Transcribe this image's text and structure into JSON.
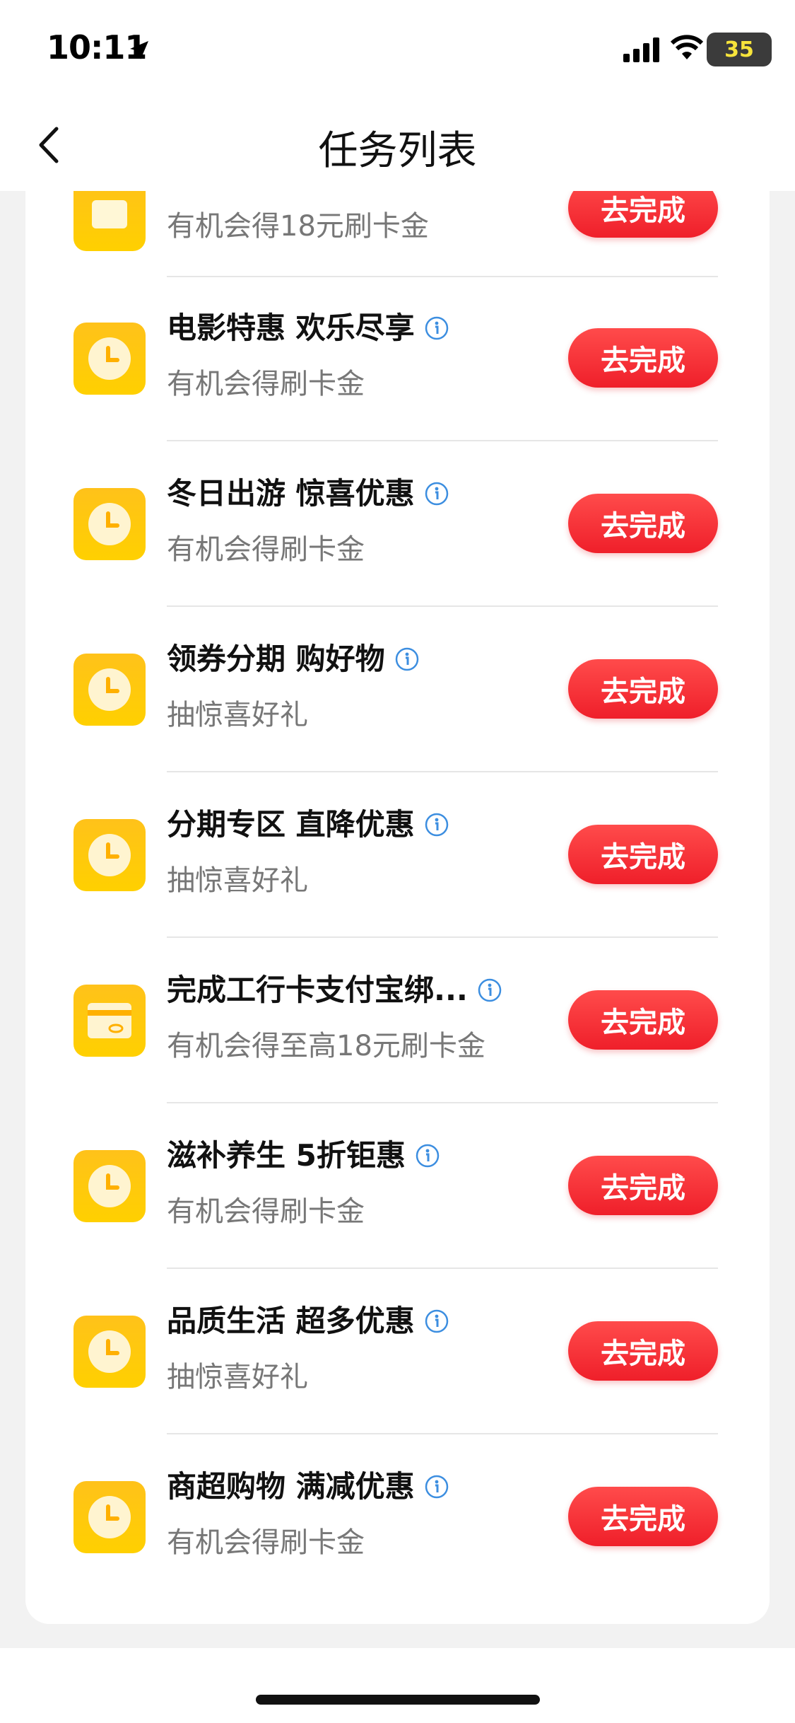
{
  "status_bar": {
    "time": "10:11",
    "battery": "35",
    "icons": [
      "location-arrow-icon",
      "signal-icon",
      "wifi-icon",
      "battery-icon"
    ]
  },
  "nav": {
    "title": "任务列表",
    "back_icon": "chevron-left-icon"
  },
  "colors": {
    "accent_button": "#ef1f2a",
    "icon_gradient": "#ffc21a",
    "subtitle": "#777777"
  },
  "tasks": [
    {
      "title": "",
      "subtitle": "有机会得18元刷卡金",
      "button": "去完成",
      "icon": "wallet-icon"
    },
    {
      "title": "电影特惠 欢乐尽享",
      "subtitle": "有机会得刷卡金",
      "button": "去完成",
      "icon": "clock-icon"
    },
    {
      "title": "冬日出游 惊喜优惠",
      "subtitle": "有机会得刷卡金",
      "button": "去完成",
      "icon": "clock-icon"
    },
    {
      "title": "领券分期 购好物",
      "subtitle": "抽惊喜好礼",
      "button": "去完成",
      "icon": "clock-icon"
    },
    {
      "title": "分期专区 直降优惠",
      "subtitle": "抽惊喜好礼",
      "button": "去完成",
      "icon": "clock-icon"
    },
    {
      "title": "完成工行卡支付宝绑...",
      "subtitle": "有机会得至高18元刷卡金",
      "button": "去完成",
      "icon": "card-icon"
    },
    {
      "title": "滋补养生 5折钜惠",
      "subtitle": "有机会得刷卡金",
      "button": "去完成",
      "icon": "clock-icon"
    },
    {
      "title": "品质生活 超多优惠",
      "subtitle": "抽惊喜好礼",
      "button": "去完成",
      "icon": "clock-icon"
    },
    {
      "title": "商超购物 满减优惠",
      "subtitle": "有机会得刷卡金",
      "button": "去完成",
      "icon": "clock-icon"
    }
  ]
}
